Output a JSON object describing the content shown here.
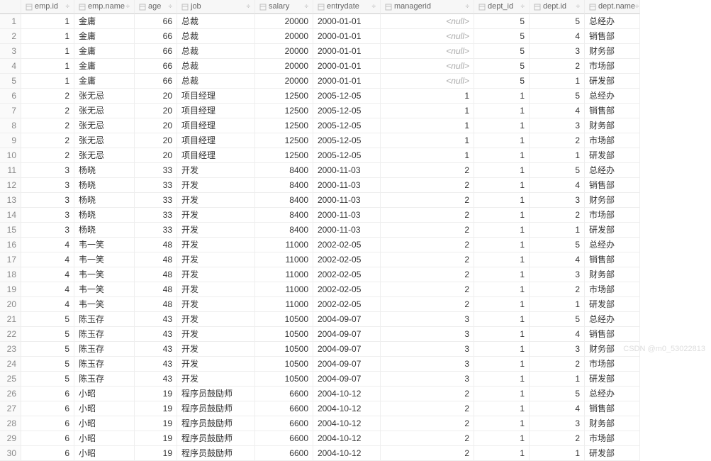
{
  "columns": [
    {
      "key": "rownum",
      "label": "",
      "type": "idx"
    },
    {
      "key": "emp_id",
      "label": "emp.id",
      "type": "num"
    },
    {
      "key": "emp_name",
      "label": "emp.name",
      "type": "txt"
    },
    {
      "key": "age",
      "label": "age",
      "type": "num"
    },
    {
      "key": "job",
      "label": "job",
      "type": "txt"
    },
    {
      "key": "salary",
      "label": "salary",
      "type": "num"
    },
    {
      "key": "entrydate",
      "label": "entrydate",
      "type": "txt"
    },
    {
      "key": "managerid",
      "label": "managerid",
      "type": "num"
    },
    {
      "key": "dept_id",
      "label": "dept_id",
      "type": "num"
    },
    {
      "key": "dept_id2",
      "label": "dept.id",
      "type": "num"
    },
    {
      "key": "dept_name",
      "label": "dept.name",
      "type": "txt"
    }
  ],
  "rows": [
    {
      "rownum": 1,
      "emp_id": 1,
      "emp_name": "金庸",
      "age": 66,
      "job": "总裁",
      "salary": 20000,
      "entrydate": "2000-01-01",
      "managerid": null,
      "dept_id": 5,
      "dept_id2": 5,
      "dept_name": "总经办"
    },
    {
      "rownum": 2,
      "emp_id": 1,
      "emp_name": "金庸",
      "age": 66,
      "job": "总裁",
      "salary": 20000,
      "entrydate": "2000-01-01",
      "managerid": null,
      "dept_id": 5,
      "dept_id2": 4,
      "dept_name": "销售部"
    },
    {
      "rownum": 3,
      "emp_id": 1,
      "emp_name": "金庸",
      "age": 66,
      "job": "总裁",
      "salary": 20000,
      "entrydate": "2000-01-01",
      "managerid": null,
      "dept_id": 5,
      "dept_id2": 3,
      "dept_name": "财务部"
    },
    {
      "rownum": 4,
      "emp_id": 1,
      "emp_name": "金庸",
      "age": 66,
      "job": "总裁",
      "salary": 20000,
      "entrydate": "2000-01-01",
      "managerid": null,
      "dept_id": 5,
      "dept_id2": 2,
      "dept_name": "市场部"
    },
    {
      "rownum": 5,
      "emp_id": 1,
      "emp_name": "金庸",
      "age": 66,
      "job": "总裁",
      "salary": 20000,
      "entrydate": "2000-01-01",
      "managerid": null,
      "dept_id": 5,
      "dept_id2": 1,
      "dept_name": "研发部"
    },
    {
      "rownum": 6,
      "emp_id": 2,
      "emp_name": "张无忌",
      "age": 20,
      "job": "项目经理",
      "salary": 12500,
      "entrydate": "2005-12-05",
      "managerid": 1,
      "dept_id": 1,
      "dept_id2": 5,
      "dept_name": "总经办"
    },
    {
      "rownum": 7,
      "emp_id": 2,
      "emp_name": "张无忌",
      "age": 20,
      "job": "项目经理",
      "salary": 12500,
      "entrydate": "2005-12-05",
      "managerid": 1,
      "dept_id": 1,
      "dept_id2": 4,
      "dept_name": "销售部"
    },
    {
      "rownum": 8,
      "emp_id": 2,
      "emp_name": "张无忌",
      "age": 20,
      "job": "项目经理",
      "salary": 12500,
      "entrydate": "2005-12-05",
      "managerid": 1,
      "dept_id": 1,
      "dept_id2": 3,
      "dept_name": "财务部"
    },
    {
      "rownum": 9,
      "emp_id": 2,
      "emp_name": "张无忌",
      "age": 20,
      "job": "项目经理",
      "salary": 12500,
      "entrydate": "2005-12-05",
      "managerid": 1,
      "dept_id": 1,
      "dept_id2": 2,
      "dept_name": "市场部"
    },
    {
      "rownum": 10,
      "emp_id": 2,
      "emp_name": "张无忌",
      "age": 20,
      "job": "项目经理",
      "salary": 12500,
      "entrydate": "2005-12-05",
      "managerid": 1,
      "dept_id": 1,
      "dept_id2": 1,
      "dept_name": "研发部"
    },
    {
      "rownum": 11,
      "emp_id": 3,
      "emp_name": "杨晓",
      "age": 33,
      "job": "开发",
      "salary": 8400,
      "entrydate": "2000-11-03",
      "managerid": 2,
      "dept_id": 1,
      "dept_id2": 5,
      "dept_name": "总经办"
    },
    {
      "rownum": 12,
      "emp_id": 3,
      "emp_name": "杨晓",
      "age": 33,
      "job": "开发",
      "salary": 8400,
      "entrydate": "2000-11-03",
      "managerid": 2,
      "dept_id": 1,
      "dept_id2": 4,
      "dept_name": "销售部"
    },
    {
      "rownum": 13,
      "emp_id": 3,
      "emp_name": "杨晓",
      "age": 33,
      "job": "开发",
      "salary": 8400,
      "entrydate": "2000-11-03",
      "managerid": 2,
      "dept_id": 1,
      "dept_id2": 3,
      "dept_name": "财务部"
    },
    {
      "rownum": 14,
      "emp_id": 3,
      "emp_name": "杨晓",
      "age": 33,
      "job": "开发",
      "salary": 8400,
      "entrydate": "2000-11-03",
      "managerid": 2,
      "dept_id": 1,
      "dept_id2": 2,
      "dept_name": "市场部"
    },
    {
      "rownum": 15,
      "emp_id": 3,
      "emp_name": "杨晓",
      "age": 33,
      "job": "开发",
      "salary": 8400,
      "entrydate": "2000-11-03",
      "managerid": 2,
      "dept_id": 1,
      "dept_id2": 1,
      "dept_name": "研发部"
    },
    {
      "rownum": 16,
      "emp_id": 4,
      "emp_name": "韦一笑",
      "age": 48,
      "job": "开发",
      "salary": 11000,
      "entrydate": "2002-02-05",
      "managerid": 2,
      "dept_id": 1,
      "dept_id2": 5,
      "dept_name": "总经办"
    },
    {
      "rownum": 17,
      "emp_id": 4,
      "emp_name": "韦一笑",
      "age": 48,
      "job": "开发",
      "salary": 11000,
      "entrydate": "2002-02-05",
      "managerid": 2,
      "dept_id": 1,
      "dept_id2": 4,
      "dept_name": "销售部"
    },
    {
      "rownum": 18,
      "emp_id": 4,
      "emp_name": "韦一笑",
      "age": 48,
      "job": "开发",
      "salary": 11000,
      "entrydate": "2002-02-05",
      "managerid": 2,
      "dept_id": 1,
      "dept_id2": 3,
      "dept_name": "财务部"
    },
    {
      "rownum": 19,
      "emp_id": 4,
      "emp_name": "韦一笑",
      "age": 48,
      "job": "开发",
      "salary": 11000,
      "entrydate": "2002-02-05",
      "managerid": 2,
      "dept_id": 1,
      "dept_id2": 2,
      "dept_name": "市场部"
    },
    {
      "rownum": 20,
      "emp_id": 4,
      "emp_name": "韦一笑",
      "age": 48,
      "job": "开发",
      "salary": 11000,
      "entrydate": "2002-02-05",
      "managerid": 2,
      "dept_id": 1,
      "dept_id2": 1,
      "dept_name": "研发部"
    },
    {
      "rownum": 21,
      "emp_id": 5,
      "emp_name": "陈玉存",
      "age": 43,
      "job": "开发",
      "salary": 10500,
      "entrydate": "2004-09-07",
      "managerid": 3,
      "dept_id": 1,
      "dept_id2": 5,
      "dept_name": "总经办"
    },
    {
      "rownum": 22,
      "emp_id": 5,
      "emp_name": "陈玉存",
      "age": 43,
      "job": "开发",
      "salary": 10500,
      "entrydate": "2004-09-07",
      "managerid": 3,
      "dept_id": 1,
      "dept_id2": 4,
      "dept_name": "销售部"
    },
    {
      "rownum": 23,
      "emp_id": 5,
      "emp_name": "陈玉存",
      "age": 43,
      "job": "开发",
      "salary": 10500,
      "entrydate": "2004-09-07",
      "managerid": 3,
      "dept_id": 1,
      "dept_id2": 3,
      "dept_name": "财务部"
    },
    {
      "rownum": 24,
      "emp_id": 5,
      "emp_name": "陈玉存",
      "age": 43,
      "job": "开发",
      "salary": 10500,
      "entrydate": "2004-09-07",
      "managerid": 3,
      "dept_id": 1,
      "dept_id2": 2,
      "dept_name": "市场部"
    },
    {
      "rownum": 25,
      "emp_id": 5,
      "emp_name": "陈玉存",
      "age": 43,
      "job": "开发",
      "salary": 10500,
      "entrydate": "2004-09-07",
      "managerid": 3,
      "dept_id": 1,
      "dept_id2": 1,
      "dept_name": "研发部"
    },
    {
      "rownum": 26,
      "emp_id": 6,
      "emp_name": "小昭",
      "age": 19,
      "job": "程序员鼓励师",
      "salary": 6600,
      "entrydate": "2004-10-12",
      "managerid": 2,
      "dept_id": 1,
      "dept_id2": 5,
      "dept_name": "总经办"
    },
    {
      "rownum": 27,
      "emp_id": 6,
      "emp_name": "小昭",
      "age": 19,
      "job": "程序员鼓励师",
      "salary": 6600,
      "entrydate": "2004-10-12",
      "managerid": 2,
      "dept_id": 1,
      "dept_id2": 4,
      "dept_name": "销售部"
    },
    {
      "rownum": 28,
      "emp_id": 6,
      "emp_name": "小昭",
      "age": 19,
      "job": "程序员鼓励师",
      "salary": 6600,
      "entrydate": "2004-10-12",
      "managerid": 2,
      "dept_id": 1,
      "dept_id2": 3,
      "dept_name": "财务部"
    },
    {
      "rownum": 29,
      "emp_id": 6,
      "emp_name": "小昭",
      "age": 19,
      "job": "程序员鼓励师",
      "salary": 6600,
      "entrydate": "2004-10-12",
      "managerid": 2,
      "dept_id": 1,
      "dept_id2": 2,
      "dept_name": "市场部"
    },
    {
      "rownum": 30,
      "emp_id": 6,
      "emp_name": "小昭",
      "age": 19,
      "job": "程序员鼓励师",
      "salary": 6600,
      "entrydate": "2004-10-12",
      "managerid": 2,
      "dept_id": 1,
      "dept_id2": 1,
      "dept_name": "研发部"
    }
  ],
  "null_text": "<null>",
  "watermark": "CSDN @m0_53022813"
}
